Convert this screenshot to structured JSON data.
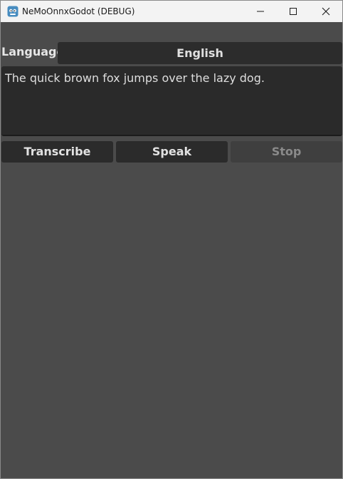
{
  "window": {
    "title": "NeMoOnnxGodot (DEBUG)",
    "app_icon": "godot-icon",
    "controls": {
      "minimize_icon": "minimize-icon",
      "maximize_icon": "maximize-icon",
      "close_icon": "close-icon"
    }
  },
  "form": {
    "language_label": "Language",
    "language_value": "English",
    "text_value": "The quick brown fox jumps over the lazy dog."
  },
  "buttons": {
    "transcribe": "Transcribe",
    "speak": "Speak",
    "stop": "Stop"
  },
  "colors": {
    "background": "#4b4b4b",
    "field": "#2c2c2c",
    "disabled_button": "#3f3f3f",
    "titlebar": "#f3f3f3"
  }
}
